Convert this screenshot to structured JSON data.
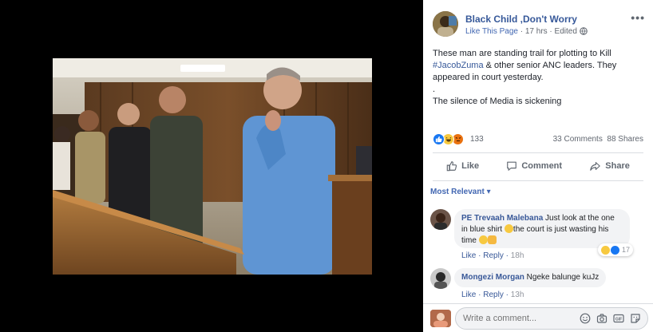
{
  "post": {
    "page_name": "Black Child ,Don't Worry",
    "like_page": "Like This Page",
    "separator": " · ",
    "time": "17 hrs",
    "edited": "Edited",
    "more": "•••",
    "text_line1_pre": "These man are standing trail for plotting to Kill ",
    "hashtag": "#JacobZuma",
    "text_line1_post": " & other senior ANC leaders. They appeared in court yesterday.",
    "dot": ".",
    "text_line3": "The silence of Media is sickening"
  },
  "reactions": {
    "count": "133",
    "comments": "33 Comments",
    "shares": "88 Shares"
  },
  "actions": {
    "like": "Like",
    "comment": "Comment",
    "share": "Share"
  },
  "sort": {
    "label": "Most Relevant",
    "caret": "▾"
  },
  "comments": [
    {
      "author": "PE Trevaah Malebana",
      "text_pre": " Just look at the one in blue shirt ",
      "text_mid": "the court is just wasting his time ",
      "like": "Like",
      "reply": "Reply",
      "time": "18h",
      "reaction_count": "17"
    },
    {
      "author": "Mongezi Morgan",
      "text": " Ngeke balunge kuJz",
      "like": "Like",
      "reply": "Reply",
      "time": "13h"
    }
  ],
  "compose": {
    "placeholder": "Write a comment..."
  },
  "colors": {
    "link": "#365899",
    "accent": "#4267b2",
    "muted": "#616770"
  }
}
